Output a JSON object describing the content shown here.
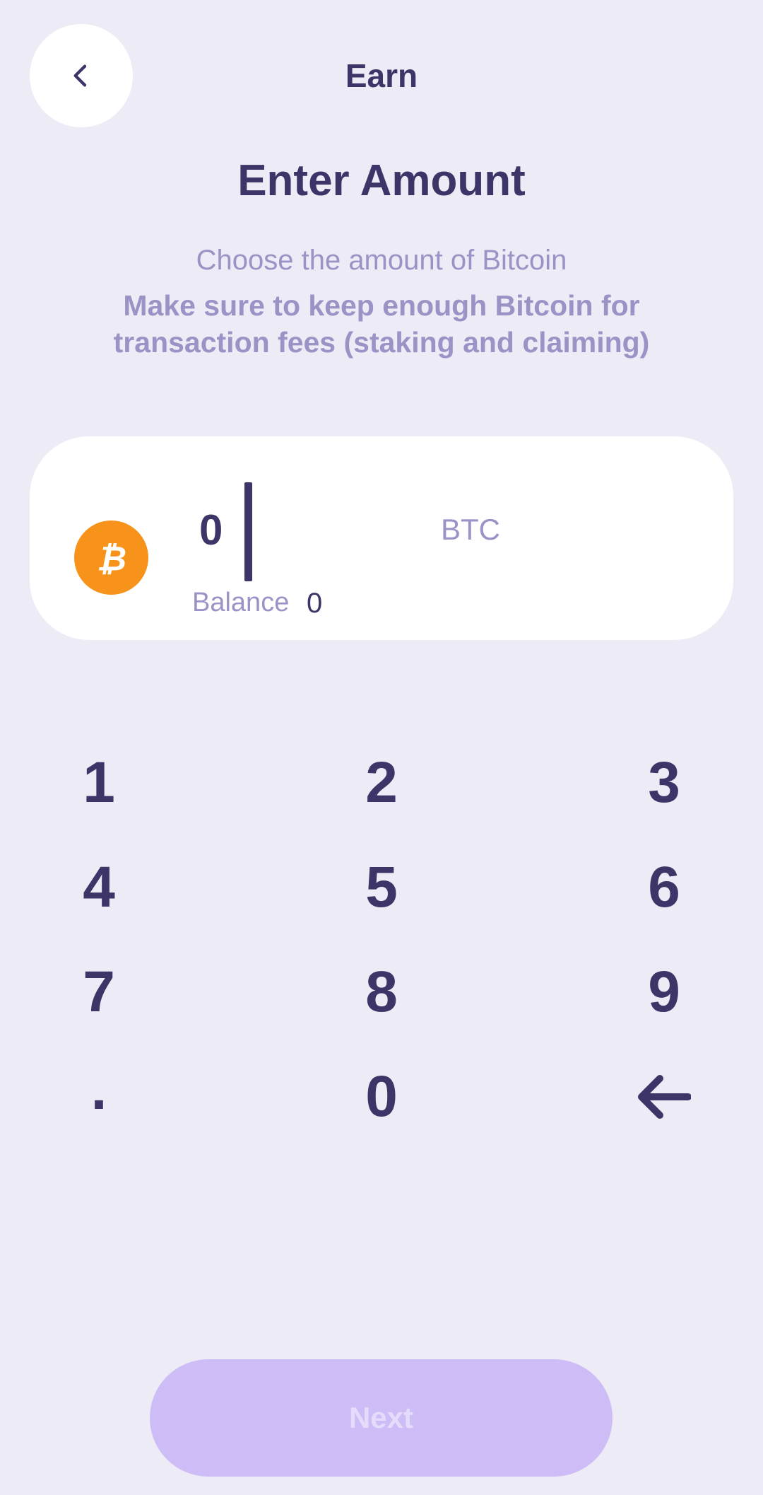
{
  "header": {
    "back_icon": "chevron-left-icon",
    "title": "Earn"
  },
  "main": {
    "title": "Enter Amount",
    "subtitle": "Choose the amount of Bitcoin",
    "warning": "Make sure to keep enough Bitcoin for transaction fees (staking and claiming)"
  },
  "amount_card": {
    "coin_icon": "bitcoin-icon",
    "amount": "0",
    "currency": "BTC",
    "balance_label": "Balance",
    "balance_value": "0"
  },
  "keypad": {
    "keys": [
      "1",
      "2",
      "3",
      "4",
      "5",
      "6",
      "7",
      "8",
      "9",
      ".",
      "0"
    ],
    "backspace_icon": "arrow-left-icon"
  },
  "footer": {
    "next_label": "Next"
  },
  "colors": {
    "background": "#EDEBF5",
    "text_primary": "#3D3567",
    "text_secondary": "#9A93C6",
    "bitcoin_orange": "#F7931A",
    "button_disabled": "#CDBCF6"
  }
}
